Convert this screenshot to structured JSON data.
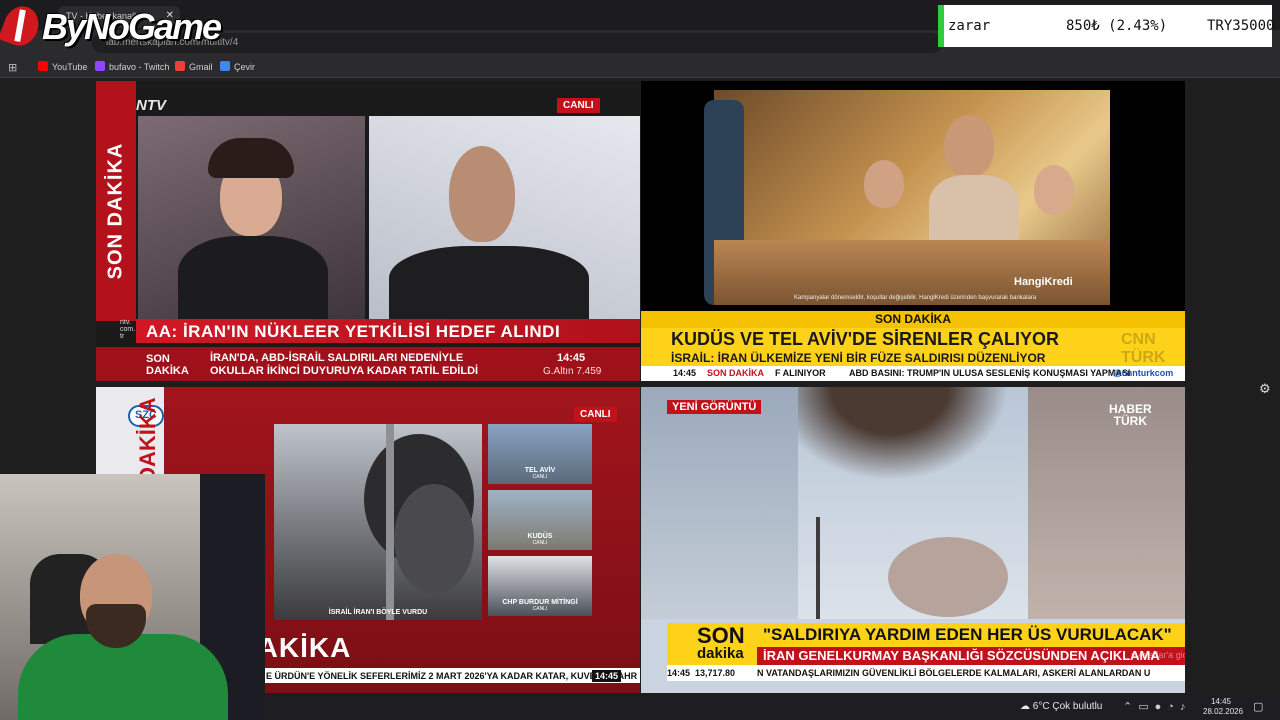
{
  "browser": {
    "tab_title": "TV - Haber kanalları",
    "url": "lab.mertskaplan.com/multitv/4",
    "bookmarks": [
      {
        "label": "YouTube",
        "color": "#ff0000"
      },
      {
        "label": "bufavo - Twitch",
        "color": "#9146ff"
      },
      {
        "label": "Gmail",
        "color": "#ea4335"
      },
      {
        "label": "Çevir",
        "color": "#4285f4"
      }
    ]
  },
  "overlay": {
    "logo_text": "ByNoGame",
    "ticker": {
      "label": "zarar",
      "change": "850₺ (2.43%)",
      "balance": "TRY35000"
    }
  },
  "panels": {
    "ntv": {
      "logo": "NTV",
      "live": "CANLI",
      "vertical": "SON DAKİKA",
      "headline": "AA: İRAN'IN NÜKLEER YETKİLİSİ HEDEF ALINDI",
      "small_logo": "ntv. com. tr",
      "bar_label": "SON DAKİKA",
      "bar_line1": "İRAN'DA, ABD-İSRAİL SALDIRILARI NEDENİYLE",
      "bar_line2": "OKULLAR İKİNCİ DUYURUYA KADAR TATİL EDİLDİ",
      "time": "14:45",
      "gold": "G.Altın  7.459"
    },
    "cnn": {
      "ad_brand": "HangiKredi",
      "ad_disclaimer": "Kampanyalar dönemseldir, koşullar değişebilir. HangiKredi üzerinden başvurarak bankalara",
      "son_dakika": "SON DAKİKA",
      "headline": "KUDÜS VE TEL AVİV'DE SİRENLER ÇALIYOR",
      "subline": "İSRAİL: İRAN ÜLKEMİZE YENİ BİR FÜZE SALDIRISI DÜZENLİYOR",
      "ticker_time": "14:45",
      "ticker_sd": "SON DAKİKA",
      "ticker_1": "F ALINIYOR",
      "ticker_2": "ABD BASINI: TRUMP'IN ULUSA SESLENİŞ KONUŞMASI YAPMASI",
      "ticker_url": "@cnnturkcom",
      "logo": "CNN TÜRK"
    },
    "szc": {
      "logo": "SZC",
      "live": "CANLI",
      "vertical": "SON DAKİKA",
      "main_caption": "İSRAİL İRAN'I BÖYLE VURDU",
      "thumbs": [
        {
          "label": "TEL AVİV",
          "sub": "CANLI"
        },
        {
          "label": "KUDÜS",
          "sub": "CANLI"
        },
        {
          "label": "CHP BURDUR MİTİNGİ",
          "sub": "CANLI"
        }
      ],
      "bottom": "SON DAKİKA",
      "ticker": "E ÜRDÜN'E YÖNELİK SEFERLERİMİZ 2 MART 2026'YA KADAR KATAR, KUVEYT, BAHR",
      "time": "14:45"
    },
    "haberturk": {
      "tag": "YENİ GÖRÜNTÜ",
      "logo_1": "HABER",
      "logo_2": "TÜRK",
      "son": "SON",
      "dakika": "dakika",
      "headline": "\"SALDIRIYA YARDIM EDEN HER ÜS VURULACAK\"",
      "subline": "İRAN GENELKURMAY BAŞKANLIĞI SÖZCÜSÜNDEN AÇIKLAMA",
      "ticker_time": "14:45",
      "ticker_value": "13,717.80",
      "ticker_text": "N VATANDAŞLARIMIZIN GÜVENLİKLİ BÖLGELERDE KALMALARI, ASKERİ ALANLARDAN U",
      "activation": "n Ayarlar'a gidin."
    }
  },
  "taskbar": {
    "weather": "6°C  Çok bulutlu",
    "time": "14:45",
    "date": "28.02.2026"
  }
}
